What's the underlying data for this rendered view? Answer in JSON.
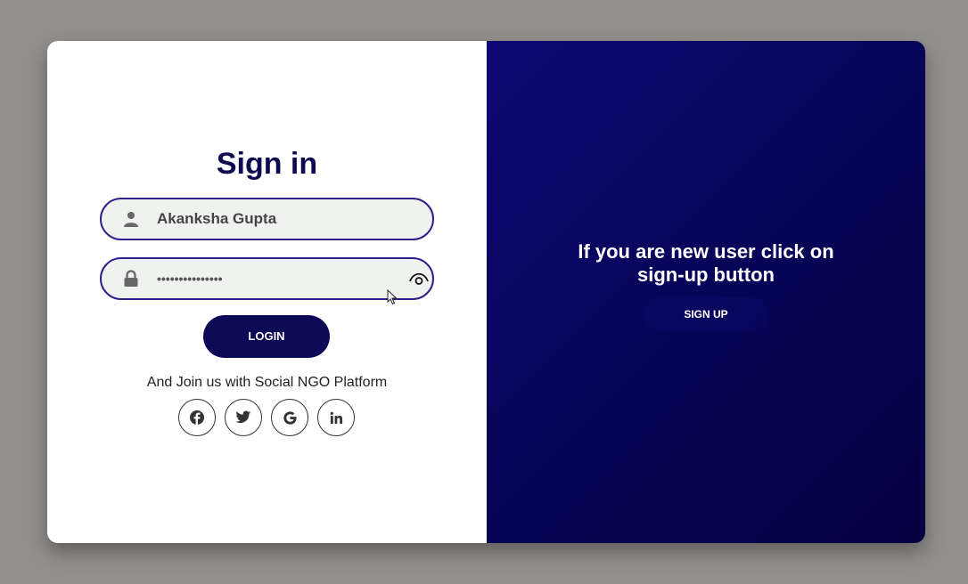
{
  "signin": {
    "title": "Sign in",
    "username_value": "Akanksha Gupta",
    "password_value": "•••••••••••••••",
    "login_label": "LOGIN",
    "join_text": "And Join us with Social NGO Platform",
    "icons": {
      "username": "user-icon",
      "password": "lock-icon",
      "toggle": "eye-icon"
    },
    "socials": [
      "facebook-icon",
      "twitter-icon",
      "google-icon",
      "linkedin-icon"
    ]
  },
  "signup_panel": {
    "message_line1": "If you are new user click on",
    "message_line2": "sign-up button",
    "signup_label": "SIGN UP"
  },
  "colors": {
    "background": "#938f8c",
    "brand_navy": "#0c0957",
    "title": "#0d0a52",
    "field_border": "#2e1f8c",
    "field_bg": "#f0f2f0",
    "panel_gradient_start": "#0c0874",
    "panel_gradient_end": "#040240"
  }
}
